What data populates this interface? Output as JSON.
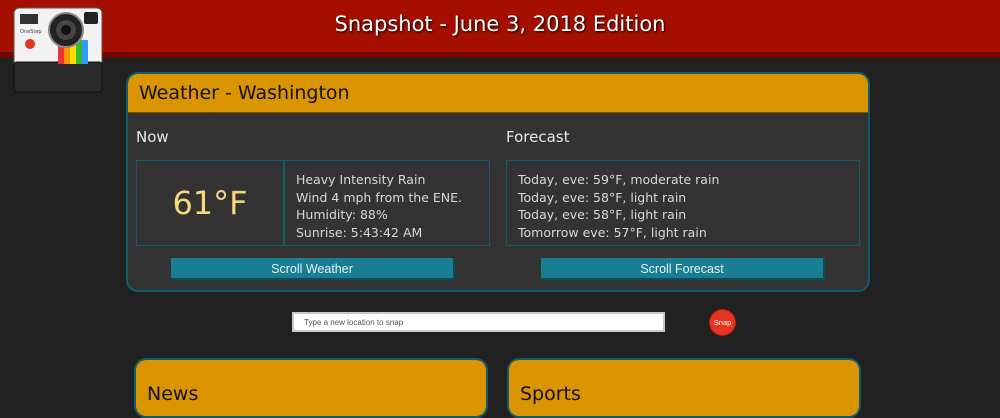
{
  "header": {
    "title": "Snapshot - June 3, 2018 Edition",
    "logo_icon": "instant-camera-icon",
    "logo_text": "OneStep"
  },
  "weather": {
    "title": "Weather - Washington",
    "now_label": "Now",
    "forecast_label": "Forecast",
    "temperature": "61°F",
    "details": [
      "Heavy Intensity Rain",
      "Wind 4 mph from the ENE.",
      "Humidity: 88%",
      "Sunrise: 5:43:42 AM"
    ],
    "forecast": [
      "Today, eve: 59°F, moderate rain",
      "Today, eve: 58°F, light rain",
      "Today, eve: 58°F, light rain",
      "Tomorrow eve: 57°F, light rain"
    ],
    "scroll_weather_label": "Scroll Weather",
    "scroll_forecast_label": "Scroll Forecast"
  },
  "search": {
    "placeholder": "Type a new location to snap",
    "value": "",
    "snap_label": "Snap"
  },
  "news": {
    "title": "News"
  },
  "sports": {
    "title": "Sports"
  },
  "colors": {
    "topbar": "#a50f00",
    "background": "#212121",
    "panel_header": "#d99400",
    "panel_body": "#333333",
    "panel_border": "#0e5d6e",
    "button": "#197e92",
    "temperature": "#f6d77a",
    "snap_button": "#e53420"
  }
}
